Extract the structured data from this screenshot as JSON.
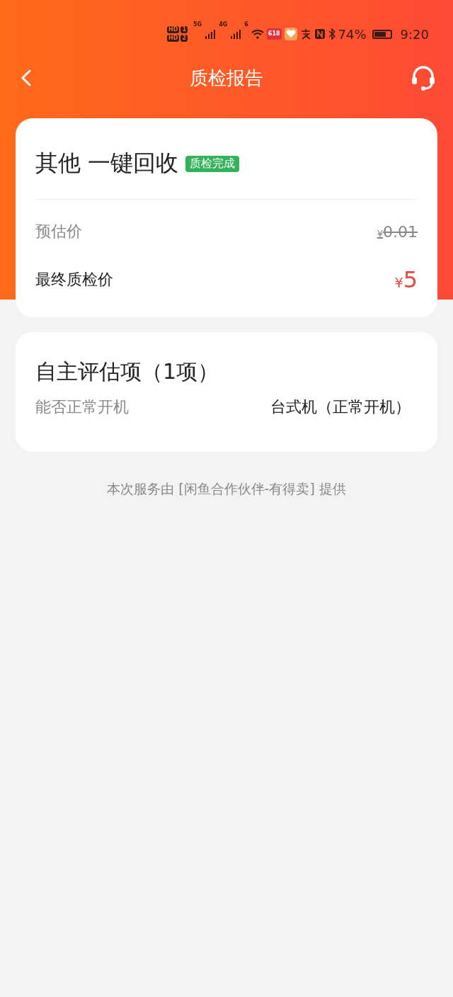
{
  "status_bar": {
    "sims": [
      {
        "hd": "HD",
        "slot": "1",
        "net": "5G"
      },
      {
        "hd": "HD",
        "slot": "2",
        "net": "4G"
      }
    ],
    "wifi": "6",
    "app_badge": "618",
    "battery": "74%",
    "time": "9:20"
  },
  "header": {
    "title": "质检报告"
  },
  "summary": {
    "title": "其他 一键回收",
    "badge": "质检完成",
    "prices": [
      {
        "label": "预估价",
        "currency": "¥",
        "amount": "0.01",
        "kind": "struck"
      },
      {
        "label": "最终质检价",
        "currency": "¥",
        "amount": "5",
        "kind": "final"
      }
    ]
  },
  "assessment": {
    "title": "自主评估项（1项）",
    "items": [
      {
        "label": "能否正常开机",
        "value": "台式机（正常开机）"
      }
    ]
  },
  "footer": "本次服务由 [闲鱼合作伙伴-有得卖] 提供"
}
